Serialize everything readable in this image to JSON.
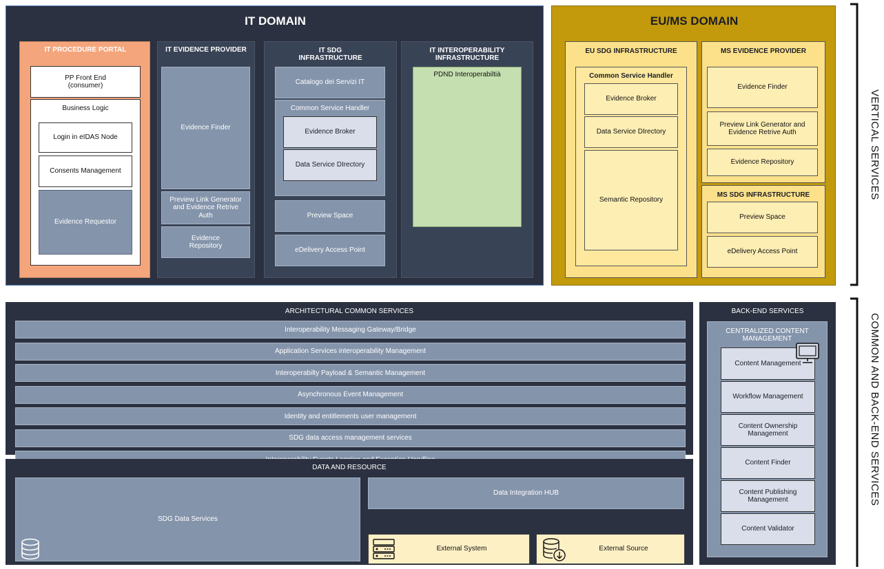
{
  "it_domain": {
    "title": "IT DOMAIN",
    "procedure_portal": {
      "title": "IT PROCEDURE PORTAL",
      "front_end": "PP Front End\n(consumer)",
      "business_logic": "Business Logic",
      "login": "Login in eIDAS Node",
      "consents": "Consents Management",
      "requestor": "Evidence Requestor"
    },
    "evidence_provider": {
      "title": "IT EVIDENCE PROVIDER",
      "finder": "Evidence Finder",
      "preview_link": "Preview Link Generator and Evidence Retrive Auth",
      "repository": "Evidence Repository"
    },
    "sdg_infra": {
      "title": "IT SDG\nINFRASTRUCTURE",
      "catalogo": "Catalogo dei Servizi IT",
      "csh": "Common Service Handler",
      "broker": "Evidence Broker",
      "directory": "Data Service DIrectory",
      "preview_space": "Preview Space",
      "edelivery": "eDelivery Access Point"
    },
    "interop_infra": {
      "title": "IT INTEROPERABILITY\nINFRASTRUCTURE",
      "pdnd": "PDND Interoperabiltià"
    }
  },
  "eu_domain": {
    "title": "EU/MS DOMAIN",
    "eu_sdg": {
      "title": "EU SDG INFRASTRUCTURE",
      "csh": "Common Service Handler",
      "broker": "Evidence Broker",
      "directory": "Data Service DIrectory",
      "semantic": "Semantic Repository"
    },
    "ms_provider": {
      "title": "MS EVIDENCE PROVIDER",
      "finder": "Evidence Finder",
      "preview_link": "Preview Link Generator and Evidence Retrive Auth",
      "repository": "Evidence Repository"
    },
    "ms_sdg": {
      "title": "MS SDG INFRASTRUCTURE",
      "preview_space": "Preview Space",
      "edelivery": "eDelivery Access Point"
    }
  },
  "common": {
    "title": "ARCHITECTURAL COMMON SERVICES",
    "rows": [
      "Interoperability Messaging Gateway/Bridge",
      "Application Services interoperability Management",
      "Interoperabilty Payload & Semantic Management",
      "Asynchronous Event Management",
      "Identity and entitlements user management",
      "SDG data access management services",
      "Interoperability Events Logging and Exception Handling"
    ]
  },
  "data": {
    "title": "DATA AND RESOURCE",
    "sdg_services": "SDG Data Services",
    "hub": "Data Integration HUB",
    "external_system": "External System",
    "external_source": "External Source"
  },
  "backend": {
    "title": "BACK-END SERVICES",
    "ccm_title": "CENTRALIZED CONTENT MANAGEMENT",
    "items": [
      "Content Management",
      "Workflow Management",
      "Content Ownership Management",
      "Content Finder",
      "Content Publishing Management",
      "Content Validator"
    ]
  },
  "side_labels": {
    "vertical": "VERTICAL SERVICES",
    "common": "COMMON AND BACK-END SERVICES"
  }
}
